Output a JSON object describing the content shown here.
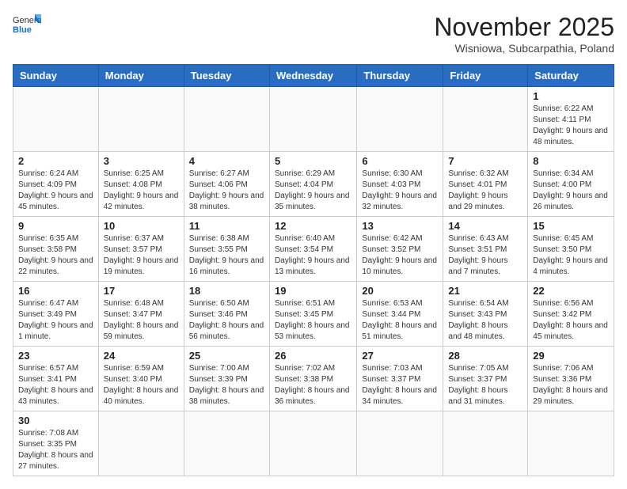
{
  "header": {
    "logo_general": "General",
    "logo_blue": "Blue",
    "month_title": "November 2025",
    "subtitle": "Wisniowa, Subcarpathia, Poland"
  },
  "weekdays": [
    "Sunday",
    "Monday",
    "Tuesday",
    "Wednesday",
    "Thursday",
    "Friday",
    "Saturday"
  ],
  "weeks": [
    [
      {
        "day": "",
        "info": ""
      },
      {
        "day": "",
        "info": ""
      },
      {
        "day": "",
        "info": ""
      },
      {
        "day": "",
        "info": ""
      },
      {
        "day": "",
        "info": ""
      },
      {
        "day": "",
        "info": ""
      },
      {
        "day": "1",
        "info": "Sunrise: 6:22 AM\nSunset: 4:11 PM\nDaylight: 9 hours and 48 minutes."
      }
    ],
    [
      {
        "day": "2",
        "info": "Sunrise: 6:24 AM\nSunset: 4:09 PM\nDaylight: 9 hours and 45 minutes."
      },
      {
        "day": "3",
        "info": "Sunrise: 6:25 AM\nSunset: 4:08 PM\nDaylight: 9 hours and 42 minutes."
      },
      {
        "day": "4",
        "info": "Sunrise: 6:27 AM\nSunset: 4:06 PM\nDaylight: 9 hours and 38 minutes."
      },
      {
        "day": "5",
        "info": "Sunrise: 6:29 AM\nSunset: 4:04 PM\nDaylight: 9 hours and 35 minutes."
      },
      {
        "day": "6",
        "info": "Sunrise: 6:30 AM\nSunset: 4:03 PM\nDaylight: 9 hours and 32 minutes."
      },
      {
        "day": "7",
        "info": "Sunrise: 6:32 AM\nSunset: 4:01 PM\nDaylight: 9 hours and 29 minutes."
      },
      {
        "day": "8",
        "info": "Sunrise: 6:34 AM\nSunset: 4:00 PM\nDaylight: 9 hours and 26 minutes."
      }
    ],
    [
      {
        "day": "9",
        "info": "Sunrise: 6:35 AM\nSunset: 3:58 PM\nDaylight: 9 hours and 22 minutes."
      },
      {
        "day": "10",
        "info": "Sunrise: 6:37 AM\nSunset: 3:57 PM\nDaylight: 9 hours and 19 minutes."
      },
      {
        "day": "11",
        "info": "Sunrise: 6:38 AM\nSunset: 3:55 PM\nDaylight: 9 hours and 16 minutes."
      },
      {
        "day": "12",
        "info": "Sunrise: 6:40 AM\nSunset: 3:54 PM\nDaylight: 9 hours and 13 minutes."
      },
      {
        "day": "13",
        "info": "Sunrise: 6:42 AM\nSunset: 3:52 PM\nDaylight: 9 hours and 10 minutes."
      },
      {
        "day": "14",
        "info": "Sunrise: 6:43 AM\nSunset: 3:51 PM\nDaylight: 9 hours and 7 minutes."
      },
      {
        "day": "15",
        "info": "Sunrise: 6:45 AM\nSunset: 3:50 PM\nDaylight: 9 hours and 4 minutes."
      }
    ],
    [
      {
        "day": "16",
        "info": "Sunrise: 6:47 AM\nSunset: 3:49 PM\nDaylight: 9 hours and 1 minute."
      },
      {
        "day": "17",
        "info": "Sunrise: 6:48 AM\nSunset: 3:47 PM\nDaylight: 8 hours and 59 minutes."
      },
      {
        "day": "18",
        "info": "Sunrise: 6:50 AM\nSunset: 3:46 PM\nDaylight: 8 hours and 56 minutes."
      },
      {
        "day": "19",
        "info": "Sunrise: 6:51 AM\nSunset: 3:45 PM\nDaylight: 8 hours and 53 minutes."
      },
      {
        "day": "20",
        "info": "Sunrise: 6:53 AM\nSunset: 3:44 PM\nDaylight: 8 hours and 51 minutes."
      },
      {
        "day": "21",
        "info": "Sunrise: 6:54 AM\nSunset: 3:43 PM\nDaylight: 8 hours and 48 minutes."
      },
      {
        "day": "22",
        "info": "Sunrise: 6:56 AM\nSunset: 3:42 PM\nDaylight: 8 hours and 45 minutes."
      }
    ],
    [
      {
        "day": "23",
        "info": "Sunrise: 6:57 AM\nSunset: 3:41 PM\nDaylight: 8 hours and 43 minutes."
      },
      {
        "day": "24",
        "info": "Sunrise: 6:59 AM\nSunset: 3:40 PM\nDaylight: 8 hours and 40 minutes."
      },
      {
        "day": "25",
        "info": "Sunrise: 7:00 AM\nSunset: 3:39 PM\nDaylight: 8 hours and 38 minutes."
      },
      {
        "day": "26",
        "info": "Sunrise: 7:02 AM\nSunset: 3:38 PM\nDaylight: 8 hours and 36 minutes."
      },
      {
        "day": "27",
        "info": "Sunrise: 7:03 AM\nSunset: 3:37 PM\nDaylight: 8 hours and 34 minutes."
      },
      {
        "day": "28",
        "info": "Sunrise: 7:05 AM\nSunset: 3:37 PM\nDaylight: 8 hours and 31 minutes."
      },
      {
        "day": "29",
        "info": "Sunrise: 7:06 AM\nSunset: 3:36 PM\nDaylight: 8 hours and 29 minutes."
      }
    ],
    [
      {
        "day": "30",
        "info": "Sunrise: 7:08 AM\nSunset: 3:35 PM\nDaylight: 8 hours and 27 minutes."
      },
      {
        "day": "",
        "info": ""
      },
      {
        "day": "",
        "info": ""
      },
      {
        "day": "",
        "info": ""
      },
      {
        "day": "",
        "info": ""
      },
      {
        "day": "",
        "info": ""
      },
      {
        "day": "",
        "info": ""
      }
    ]
  ]
}
